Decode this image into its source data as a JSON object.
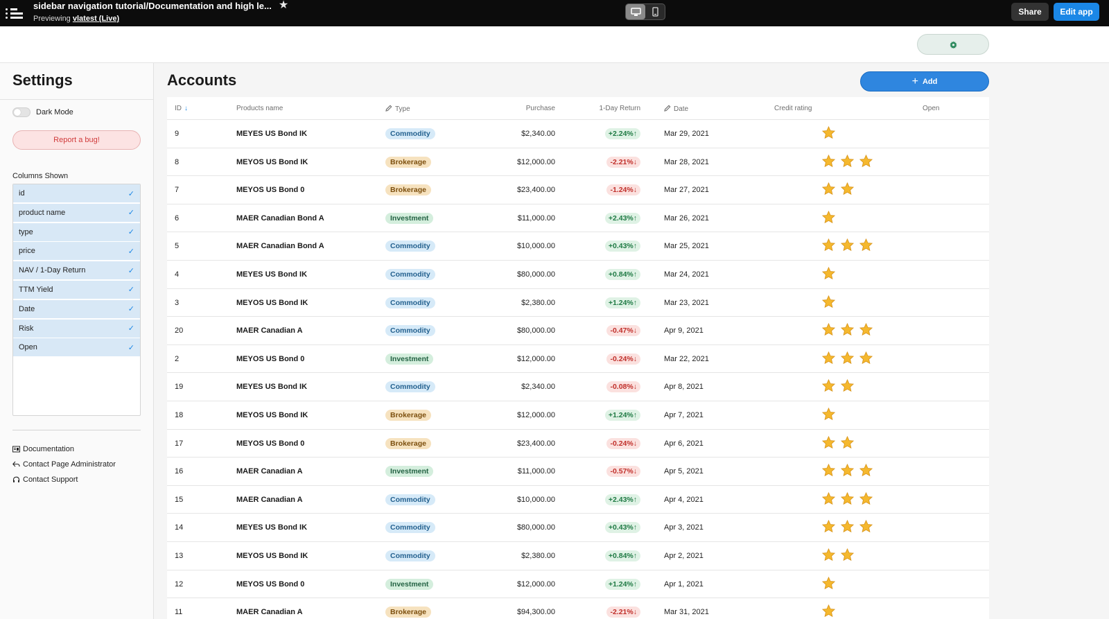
{
  "topbar": {
    "app_title": "sidebar navigation tutorial/Documentation and high le...",
    "previewing_prefix": "Previewing",
    "version_link": "vlatest (Live)",
    "share_label": "Share",
    "edit_label": "Edit app"
  },
  "sidebar": {
    "title": "Settings",
    "dark_mode_label": "Dark Mode",
    "report_bug_label": "Report a bug!",
    "columns_shown_label": "Columns Shown",
    "columns": [
      "id",
      "product name",
      "type",
      "price",
      "NAV / 1-Day Return",
      "TTM Yield",
      "Date",
      "Risk",
      "Open"
    ],
    "links": [
      "Documentation",
      "Contact Page Administrator",
      "Contact Support"
    ]
  },
  "main": {
    "title": "Accounts",
    "add_label": "Add",
    "headers": {
      "id": "ID",
      "name": "Products name",
      "type": "Type",
      "purchase": "Purchase",
      "return": "1-Day Return",
      "date": "Date",
      "rating": "Credit rating",
      "open": "Open"
    },
    "rows": [
      {
        "id": "9",
        "name": "MEYES US Bond IK",
        "type": "Commodity",
        "purchase": "$2,340.00",
        "ret": "+2.24%",
        "dir": "up",
        "date": "Mar 29, 2021",
        "stars": 1
      },
      {
        "id": "8",
        "name": "MEYOS US Bond IK",
        "type": "Brokerage",
        "purchase": "$12,000.00",
        "ret": "-2.21%",
        "dir": "down",
        "date": "Mar 28, 2021",
        "stars": 3
      },
      {
        "id": "7",
        "name": "MEYOS US Bond 0",
        "type": "Brokerage",
        "purchase": "$23,400.00",
        "ret": "-1.24%",
        "dir": "down",
        "date": "Mar 27, 2021",
        "stars": 2
      },
      {
        "id": "6",
        "name": "MAER Canadian Bond A",
        "type": "Investment",
        "purchase": "$11,000.00",
        "ret": "+2.43%",
        "dir": "up",
        "date": "Mar 26, 2021",
        "stars": 1
      },
      {
        "id": "5",
        "name": "MAER Canadian Bond A",
        "type": "Commodity",
        "purchase": "$10,000.00",
        "ret": "+0.43%",
        "dir": "up",
        "date": "Mar 25, 2021",
        "stars": 3
      },
      {
        "id": "4",
        "name": "MEYES US Bond IK",
        "type": "Commodity",
        "purchase": "$80,000.00",
        "ret": "+0.84%",
        "dir": "up",
        "date": "Mar 24, 2021",
        "stars": 1
      },
      {
        "id": "3",
        "name": "MEYOS US Bond IK",
        "type": "Commodity",
        "purchase": "$2,380.00",
        "ret": "+1.24%",
        "dir": "up",
        "date": "Mar 23, 2021",
        "stars": 1
      },
      {
        "id": "20",
        "name": "MAER Canadian A",
        "type": "Commodity",
        "purchase": "$80,000.00",
        "ret": "-0.47%",
        "dir": "down",
        "date": "Apr 9, 2021",
        "stars": 3
      },
      {
        "id": "2",
        "name": "MEYOS US Bond 0",
        "type": "Investment",
        "purchase": "$12,000.00",
        "ret": "-0.24%",
        "dir": "down",
        "date": "Mar 22, 2021",
        "stars": 3
      },
      {
        "id": "19",
        "name": "MEYES US Bond IK",
        "type": "Commodity",
        "purchase": "$2,340.00",
        "ret": "-0.08%",
        "dir": "down",
        "date": "Apr 8, 2021",
        "stars": 2
      },
      {
        "id": "18",
        "name": "MEYOS US Bond IK",
        "type": "Brokerage",
        "purchase": "$12,000.00",
        "ret": "+1.24%",
        "dir": "up",
        "date": "Apr 7, 2021",
        "stars": 1
      },
      {
        "id": "17",
        "name": "MEYOS US Bond 0",
        "type": "Brokerage",
        "purchase": "$23,400.00",
        "ret": "-0.24%",
        "dir": "down",
        "date": "Apr 6, 2021",
        "stars": 2
      },
      {
        "id": "16",
        "name": "MAER Canadian A",
        "type": "Investment",
        "purchase": "$11,000.00",
        "ret": "-0.57%",
        "dir": "down",
        "date": "Apr 5, 2021",
        "stars": 3
      },
      {
        "id": "15",
        "name": "MAER Canadian A",
        "type": "Commodity",
        "purchase": "$10,000.00",
        "ret": "+2.43%",
        "dir": "up",
        "date": "Apr 4, 2021",
        "stars": 3
      },
      {
        "id": "14",
        "name": "MEYES US Bond IK",
        "type": "Commodity",
        "purchase": "$80,000.00",
        "ret": "+0.43%",
        "dir": "up",
        "date": "Apr 3, 2021",
        "stars": 3
      },
      {
        "id": "13",
        "name": "MEYOS US Bond IK",
        "type": "Commodity",
        "purchase": "$2,380.00",
        "ret": "+0.84%",
        "dir": "up",
        "date": "Apr 2, 2021",
        "stars": 2
      },
      {
        "id": "12",
        "name": "MEYOS US Bond 0",
        "type": "Investment",
        "purchase": "$12,000.00",
        "ret": "+1.24%",
        "dir": "up",
        "date": "Apr 1, 2021",
        "stars": 1
      },
      {
        "id": "11",
        "name": "MAER Canadian A",
        "type": "Brokerage",
        "purchase": "$94,300.00",
        "ret": "-2.21%",
        "dir": "down",
        "date": "Mar 31, 2021",
        "stars": 1
      }
    ]
  },
  "colors": {
    "accent": "#1b87e6",
    "star": "#f5b82e",
    "up": "#1f7a44",
    "down": "#c02f2a"
  }
}
